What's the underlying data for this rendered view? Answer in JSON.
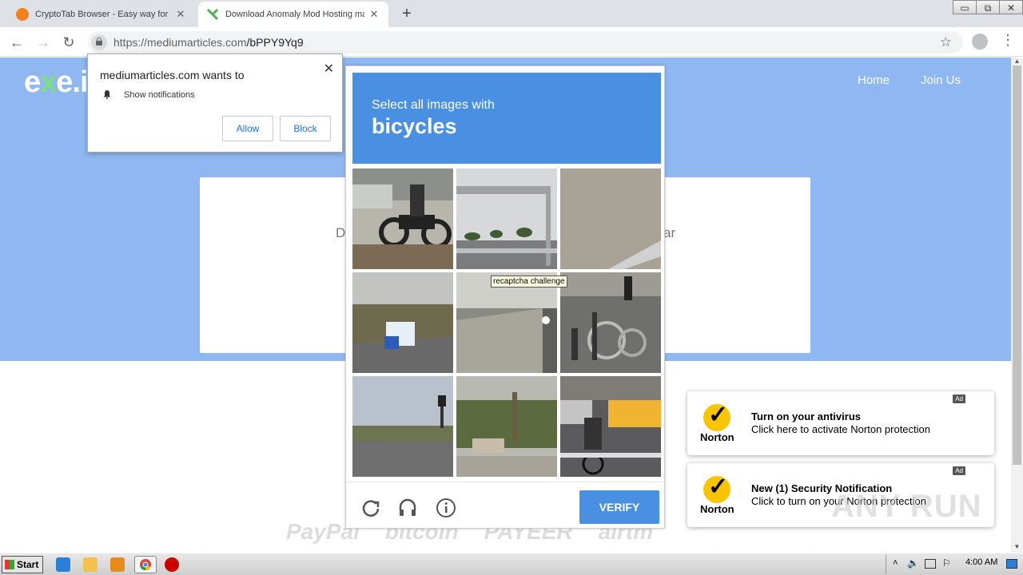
{
  "browser": {
    "tabs": [
      {
        "title": "CryptoTab Browser - Easy way for B",
        "close": "✕",
        "color": "#f48120"
      },
      {
        "title": "Download Anomaly Mod Hosting mas",
        "close": "✕",
        "color": "#4caf50"
      }
    ],
    "new_tab": "+",
    "window_controls": [
      "▭",
      "⧉",
      "✕"
    ],
    "url_host": "https://mediumarticles.com",
    "url_path": "/bPPY9Yq9",
    "back_icon": "←",
    "forward_icon": "→",
    "reload_icon": "↻",
    "bookmark_icon": "☆",
    "menu_icon": "⋮"
  },
  "page": {
    "logo_pre": "e",
    "logo_x": "x",
    "logo_post": "e.i",
    "nav": [
      "Home",
      "Join Us"
    ],
    "card_left": "D",
    "card_right": "ar",
    "payments": [
      "PayPal",
      "bitcoin",
      "PAYEER",
      "airtm"
    ],
    "hero_color": "#8fb8f2"
  },
  "permission": {
    "title": "mediumarticles.com wants to",
    "item": "Show notifications",
    "allow": "Allow",
    "block": "Block",
    "close": "✕"
  },
  "captcha": {
    "line1": "Select all images with",
    "line2": "bicycles",
    "tooltip": "recaptcha challenge",
    "verify": "VERIFY",
    "accent": "#4a90e2"
  },
  "ads": [
    {
      "badge": "Ad",
      "brand": "Norton",
      "heading": "Turn on your antivirus",
      "sub": "Click here to activate Norton protection"
    },
    {
      "badge": "Ad",
      "brand": "Norton",
      "heading": "New (1) Security Notification",
      "sub": "Click to turn on your Norton protection"
    }
  ],
  "watermark": "ANY RUN",
  "taskbar": {
    "start": "Start",
    "clock": "4:00 AM"
  }
}
